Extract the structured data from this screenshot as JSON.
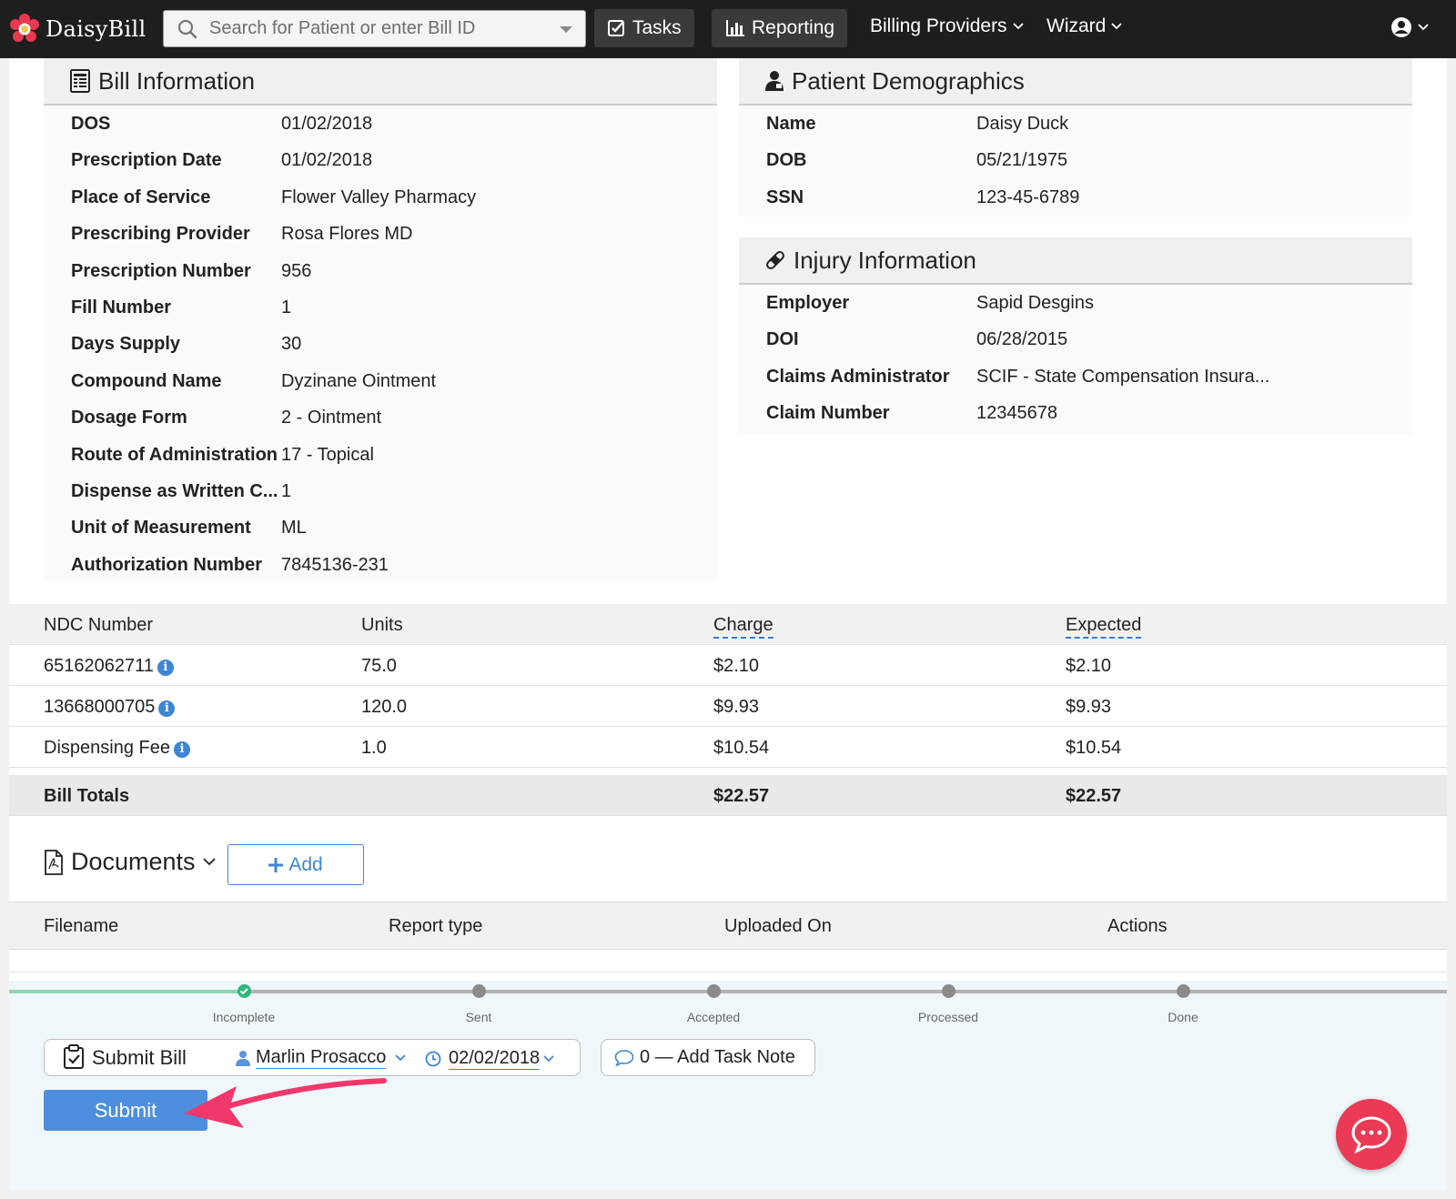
{
  "brand": {
    "name": "DaisyBill"
  },
  "search": {
    "placeholder": "Search for Patient or enter Bill ID"
  },
  "nav": {
    "tasks": "Tasks",
    "reporting": "Reporting",
    "billing_providers": "Billing Providers",
    "wizard": "Wizard"
  },
  "bill_info": {
    "title": "Bill Information",
    "rows": [
      {
        "label": "DOS",
        "value": "01/02/2018"
      },
      {
        "label": "Prescription Date",
        "value": "01/02/2018"
      },
      {
        "label": "Place of Service",
        "value": "Flower Valley Pharmacy"
      },
      {
        "label": "Prescribing Provider",
        "value": "Rosa Flores MD"
      },
      {
        "label": "Prescription Number",
        "value": "956"
      },
      {
        "label": "Fill Number",
        "value": "1"
      },
      {
        "label": "Days Supply",
        "value": "30"
      },
      {
        "label": "Compound Name",
        "value": "Dyzinane Ointment"
      },
      {
        "label": "Dosage Form",
        "value": "2 - Ointment"
      },
      {
        "label": "Route of Administration",
        "value": "17 - Topical"
      },
      {
        "label": "Dispense as Written C...",
        "value": "1"
      },
      {
        "label": "Unit of Measurement",
        "value": "ML"
      },
      {
        "label": "Authorization Number",
        "value": "7845136-231"
      }
    ]
  },
  "patient": {
    "title": "Patient Demographics",
    "rows": [
      {
        "label": "Name",
        "value": "Daisy Duck"
      },
      {
        "label": "DOB",
        "value": "05/21/1975"
      },
      {
        "label": "SSN",
        "value": "123-45-6789"
      }
    ]
  },
  "injury": {
    "title": "Injury Information",
    "rows": [
      {
        "label": "Employer",
        "value": "Sapid Desgins"
      },
      {
        "label": "DOI",
        "value": "06/28/2015"
      },
      {
        "label": "Claims Administrator",
        "value": "SCIF - State Compensation Insura..."
      },
      {
        "label": "Claim Number",
        "value": "12345678"
      }
    ]
  },
  "ndc_table": {
    "headers": [
      "NDC Number",
      "Units",
      "Charge",
      "Expected"
    ],
    "rows": [
      {
        "ndc": "65162062711",
        "units": "75.0",
        "charge": "$2.10",
        "expected": "$2.10"
      },
      {
        "ndc": "13668000705",
        "units": "120.0",
        "charge": "$9.93",
        "expected": "$9.93"
      },
      {
        "ndc": "Dispensing Fee",
        "units": "1.0",
        "charge": "$10.54",
        "expected": "$10.54"
      }
    ],
    "totals": {
      "label": "Bill Totals",
      "charge": "$22.57",
      "expected": "$22.57"
    }
  },
  "documents": {
    "title": "Documents",
    "add_label": "Add",
    "headers": [
      "Filename",
      "Report type",
      "Uploaded On",
      "Actions"
    ]
  },
  "workflow": {
    "steps": [
      "Incomplete",
      "Sent",
      "Accepted",
      "Processed",
      "Done"
    ],
    "current_step": "Incomplete",
    "task_label": "Submit Bill",
    "assignee": "Marlin Prosacco",
    "due_date": "02/02/2018",
    "note_label": "0 — Add Task Note",
    "submit_label": "Submit"
  },
  "colors": {
    "navbar": "#1e1e1e",
    "accent": "#4d8fde",
    "annotation_arrow": "#f0386b",
    "chat": "#ea3a55",
    "progress_done": "#8ed6b4"
  }
}
